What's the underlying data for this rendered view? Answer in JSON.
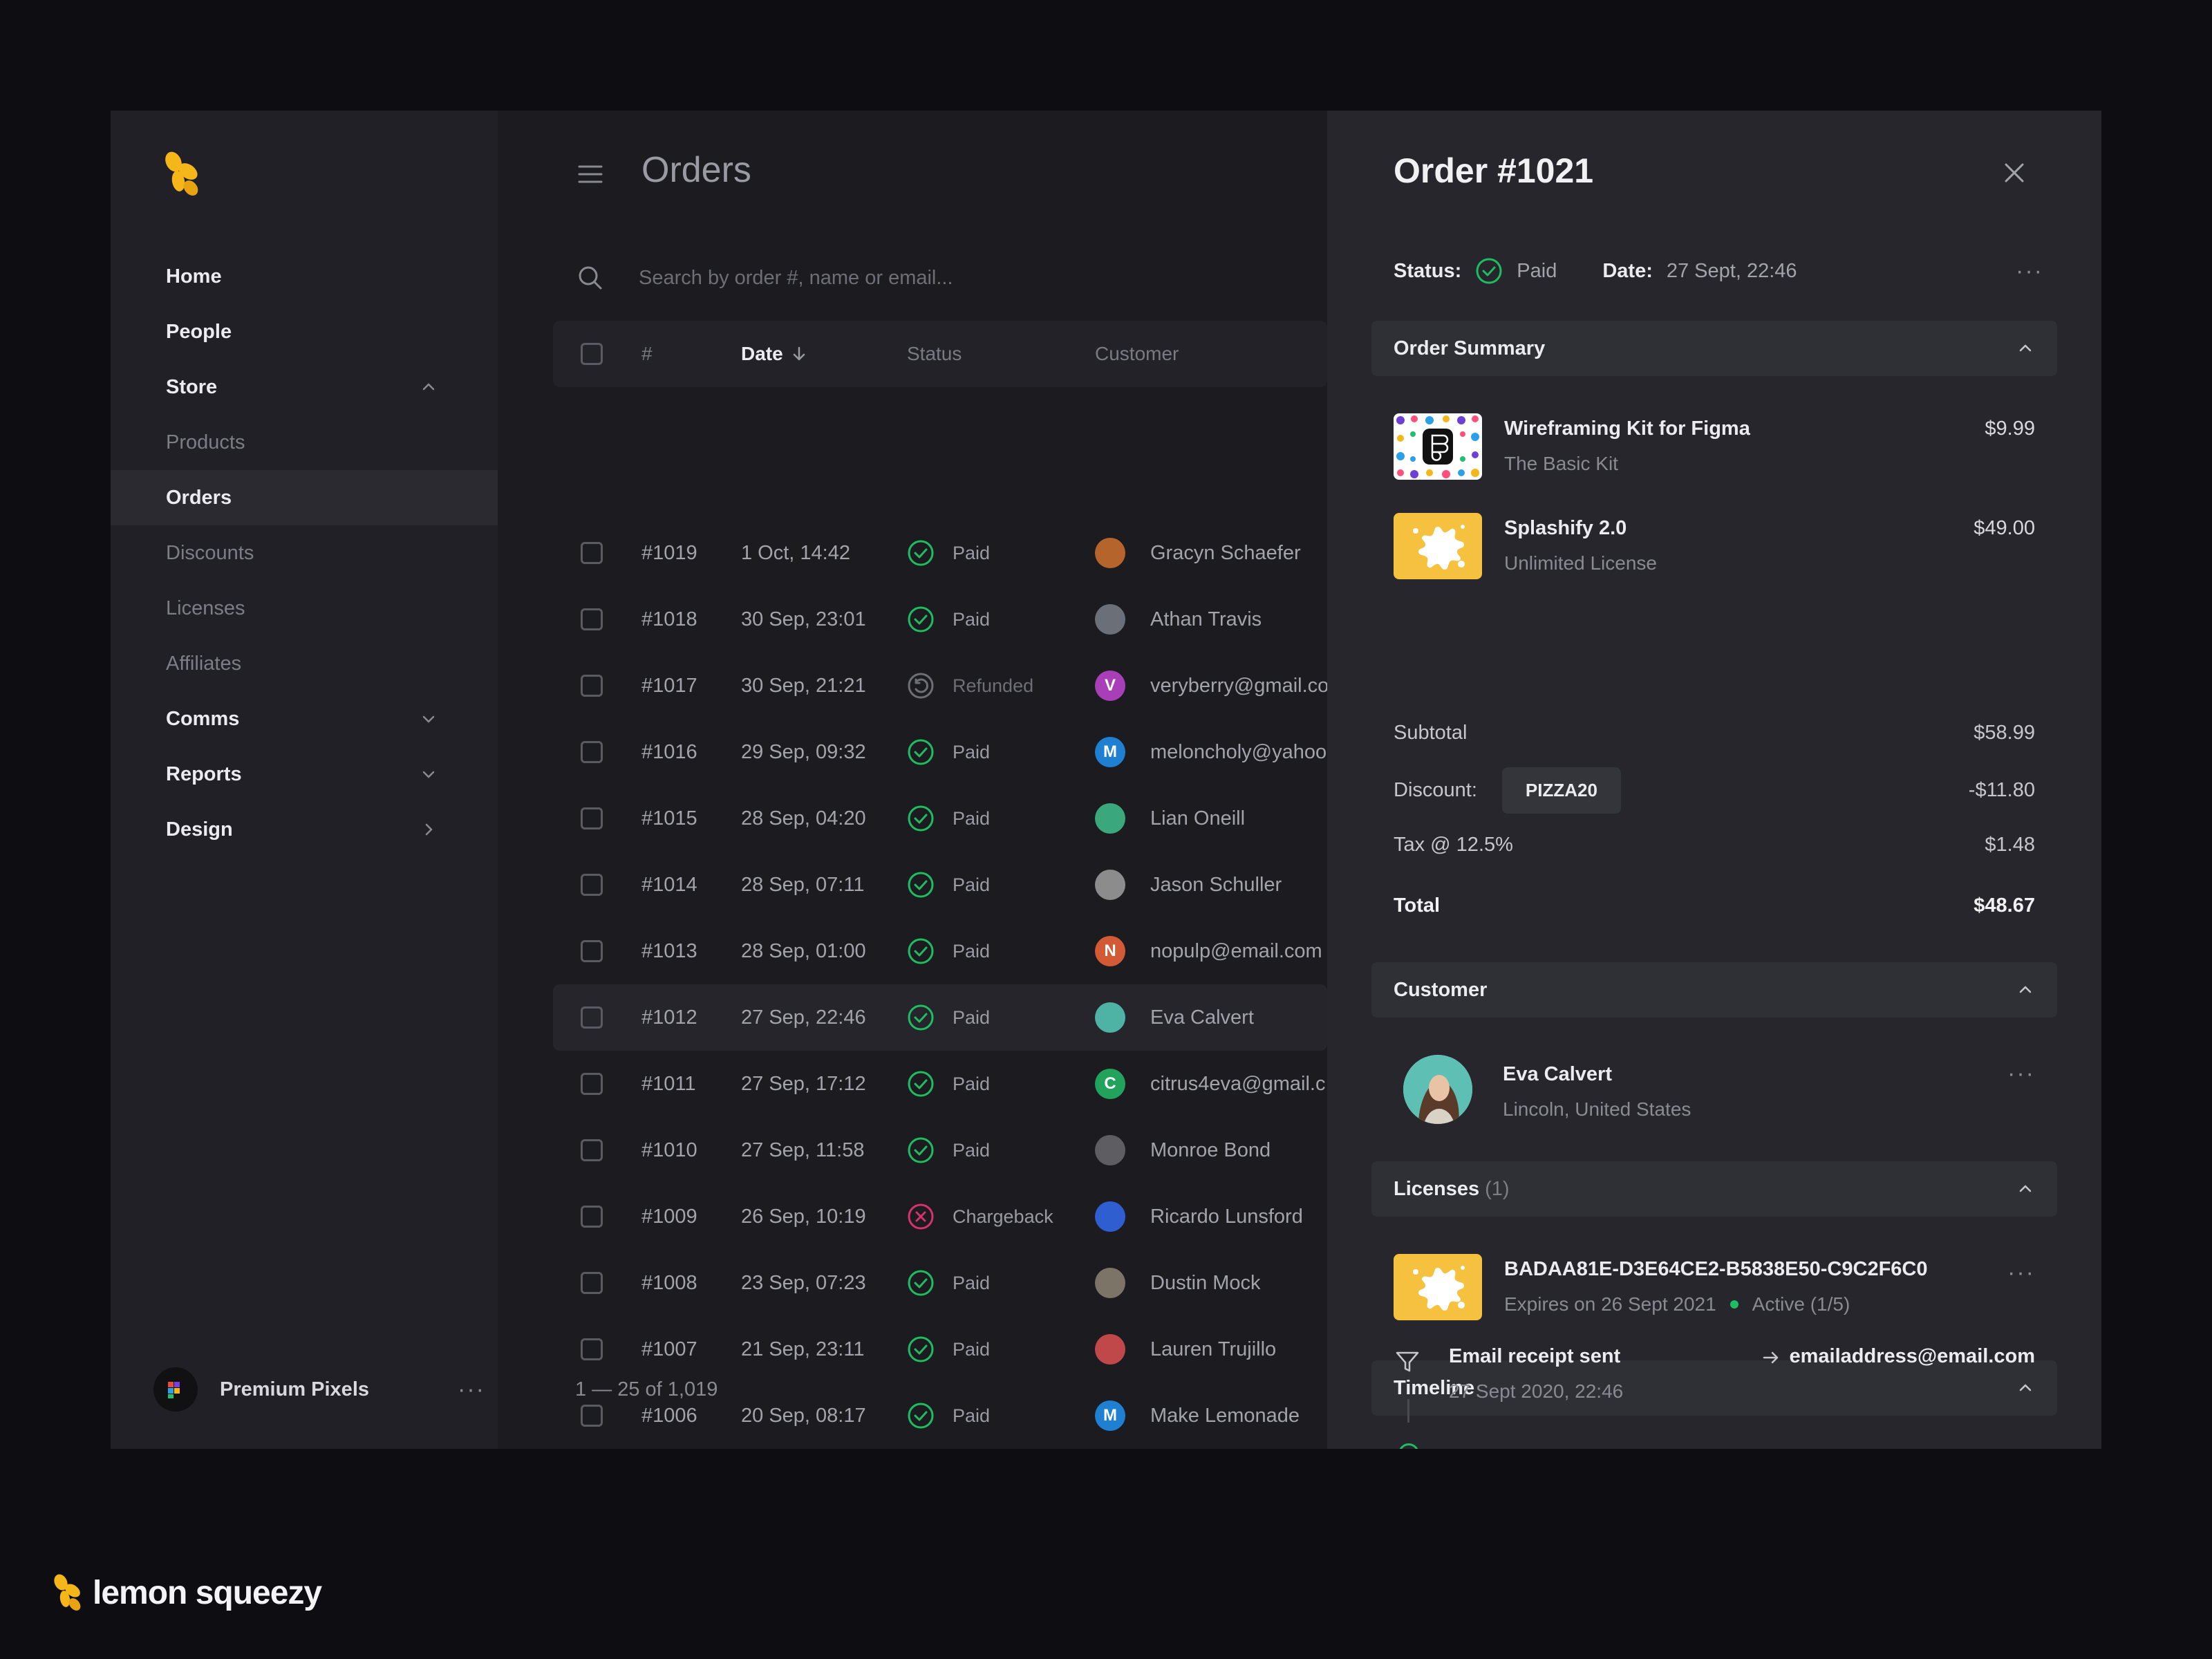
{
  "sidebar": {
    "items": [
      {
        "label": "Home",
        "kind": "top"
      },
      {
        "label": "People",
        "kind": "top"
      },
      {
        "label": "Store",
        "kind": "top",
        "chevron": "up"
      },
      {
        "label": "Products",
        "kind": "sub"
      },
      {
        "label": "Orders",
        "kind": "active"
      },
      {
        "label": "Discounts",
        "kind": "sub"
      },
      {
        "label": "Licenses",
        "kind": "sub"
      },
      {
        "label": "Affiliates",
        "kind": "sub"
      },
      {
        "label": "Comms",
        "kind": "top",
        "chevron": "down"
      },
      {
        "label": "Reports",
        "kind": "top",
        "chevron": "down"
      },
      {
        "label": "Design",
        "kind": "top",
        "chevron": "right"
      }
    ],
    "workspace": {
      "name": "Premium Pixels",
      "menu": "···"
    }
  },
  "orders": {
    "title": "Orders",
    "search": {
      "placeholder": "Search by order #, name or email..."
    },
    "columns": {
      "number": "#",
      "date": "Date",
      "status": "Status",
      "customer": "Customer"
    },
    "rows": [
      {
        "id": "#1019",
        "date": "1 Oct, 14:42",
        "status": "Paid",
        "customer": "Gracyn Schaefer",
        "avatar": {
          "initial": "",
          "color": "#b5652b"
        }
      },
      {
        "id": "#1018",
        "date": "30 Sep, 23:01",
        "status": "Paid",
        "customer": "Athan Travis",
        "avatar": {
          "initial": "",
          "color": "#6b6f78"
        }
      },
      {
        "id": "#1017",
        "date": "30 Sep, 21:21",
        "status": "Refunded",
        "customer": "veryberry@gmail.co",
        "avatar": {
          "initial": "V",
          "color": "#a83fb8"
        }
      },
      {
        "id": "#1016",
        "date": "29 Sep, 09:32",
        "status": "Paid",
        "customer": "meloncholy@yahoo",
        "avatar": {
          "initial": "M",
          "color": "#1f7fd1"
        }
      },
      {
        "id": "#1015",
        "date": "28 Sep, 04:20",
        "status": "Paid",
        "customer": "Lian Oneill",
        "avatar": {
          "initial": "",
          "color": "#3aa77d"
        }
      },
      {
        "id": "#1014",
        "date": "28 Sep, 07:11",
        "status": "Paid",
        "customer": "Jason Schuller",
        "avatar": {
          "initial": "",
          "color": "#8c8c8c"
        }
      },
      {
        "id": "#1013",
        "date": "28 Sep, 01:00",
        "status": "Paid",
        "customer": "nopulp@email.com",
        "avatar": {
          "initial": "N",
          "color": "#d25a34"
        }
      },
      {
        "id": "#1012",
        "date": "27 Sep, 22:46",
        "status": "Paid",
        "customer": "Eva Calvert",
        "avatar": {
          "initial": "",
          "color": "#4eb3a5"
        }
      },
      {
        "id": "#1011",
        "date": "27 Sep, 17:12",
        "status": "Paid",
        "customer": "citrus4eva@gmail.c",
        "avatar": {
          "initial": "C",
          "color": "#21a35b"
        }
      },
      {
        "id": "#1010",
        "date": "27 Sep, 11:58",
        "status": "Paid",
        "customer": "Monroe Bond",
        "avatar": {
          "initial": "",
          "color": "#5e5e62"
        }
      },
      {
        "id": "#1009",
        "date": "26 Sep, 10:19",
        "status": "Chargeback",
        "customer": "Ricardo Lunsford",
        "avatar": {
          "initial": "",
          "color": "#2f5ed1"
        }
      },
      {
        "id": "#1008",
        "date": "23 Sep, 07:23",
        "status": "Paid",
        "customer": "Dustin Mock",
        "avatar": {
          "initial": "",
          "color": "#7d7468"
        }
      },
      {
        "id": "#1007",
        "date": "21 Sep, 23:11",
        "status": "Paid",
        "customer": "Lauren Trujillo",
        "avatar": {
          "initial": "",
          "color": "#c1484a"
        }
      },
      {
        "id": "#1006",
        "date": "20 Sep, 08:17",
        "status": "Paid",
        "customer": "Make Lemonade",
        "avatar": {
          "initial": "M",
          "color": "#1f7fd1"
        }
      }
    ],
    "pagination": "1 — 25 of 1,019"
  },
  "order": {
    "title": "Order #1021",
    "status_label": "Status:",
    "status_value": "Paid",
    "date_label": "Date:",
    "date_value": "27 Sept, 22:46",
    "summary": {
      "heading": "Order Summary",
      "products": [
        {
          "name": "Wireframing Kit for Figma",
          "variant": "The Basic Kit",
          "price": "$9.99"
        },
        {
          "name": "Splashify 2.0",
          "variant": "Unlimited License",
          "price": "$49.00"
        }
      ],
      "subtotal_label": "Subtotal",
      "subtotal": "$58.99",
      "discount_label": "Discount:",
      "discount_code": "PIZZA20",
      "discount": "-$11.80",
      "tax_label": "Tax @ 12.5%",
      "tax": "$1.48",
      "total_label": "Total",
      "total": "$48.67"
    },
    "customer": {
      "heading": "Customer",
      "name": "Eva Calvert",
      "location": "Lincoln, United States"
    },
    "licenses": {
      "heading": "Licenses",
      "count": "(1)",
      "key": "BADAA81E-D3E64CE2-B5838E50-C9C2F6C0",
      "expires": "Expires on 26 Sept 2021",
      "state": "Active (1/5)"
    },
    "timeline": {
      "heading": "Timeline",
      "event": "Email receipt sent",
      "when": "27 Sept 2020, 22:46",
      "to": "emailaddress@email.com"
    }
  },
  "brand": {
    "name": "lemon squeezy"
  },
  "colors": {
    "accent_yellow": "#f5b619",
    "paid_green": "#1fbd62",
    "chargeback_red": "#d6336c"
  }
}
